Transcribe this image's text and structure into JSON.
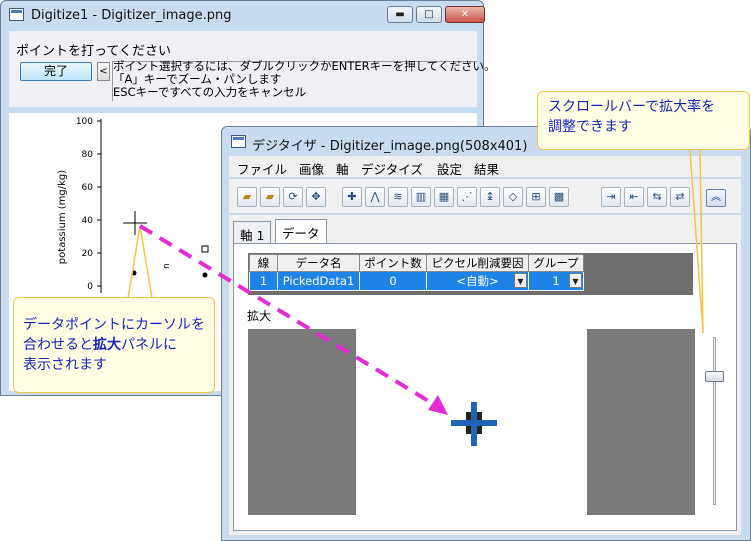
{
  "win1": {
    "title": "Digitize1 - Digitizer_image.png",
    "prompt": "ポイントを打ってください",
    "done_label": "完了",
    "arrow_label": "<",
    "instructions": "ポイント選択するには、ダブルクリックかENTERキーを押してください。\n「A」キーでズーム・パンします\nESCキーですべての入力をキャンセル",
    "y_label": "potassium (mg/kg)",
    "y_ticks": [
      "100",
      "80",
      "60",
      "40",
      "20",
      "0"
    ]
  },
  "win2": {
    "title": "デジタイザ - Digitizer_image.png(508x401)",
    "menu": [
      "ファイル",
      "画像",
      "軸",
      "デジタイズ",
      "設定",
      "結果"
    ],
    "tabs": [
      "軸 1",
      "データ"
    ],
    "table": {
      "headers": [
        "線",
        "データ名",
        "ポイント数",
        "ピクセル削減要因",
        "グループ"
      ],
      "row": {
        "line": "1",
        "name": "PickedData1",
        "points": "0",
        "reduction": "<自動>",
        "group": "1"
      }
    },
    "magnify_label": "拡大"
  },
  "callouts": {
    "right_line1": "スクロールバーで拡大率を",
    "right_line2": "調整できます",
    "left_line1": "データポイントにカーソルを",
    "left_line2a": "合わせると",
    "left_line2b": "拡大",
    "left_line2c": "パネルに",
    "left_line3": "表示されます"
  },
  "colors": {
    "accent": "#1e83e6",
    "callout_border": "#f3c544",
    "arrow": "#e62ad5",
    "crosshair": "#1f64b7"
  },
  "icons": [
    "open-folder-icon",
    "open-file-icon",
    "rotate-icon",
    "move-axes-icon",
    "pick-points-icon",
    "mountain-a-icon",
    "mountain-b-icon",
    "mountain-c-icon",
    "mountain-d-icon",
    "mountain-e-icon",
    "edge-icon",
    "tag-icon",
    "add-point-icon",
    "grid-icon",
    "export-table-icon",
    "export-b-icon",
    "export-c-icon",
    "export-d-icon",
    "collapse-icon"
  ]
}
